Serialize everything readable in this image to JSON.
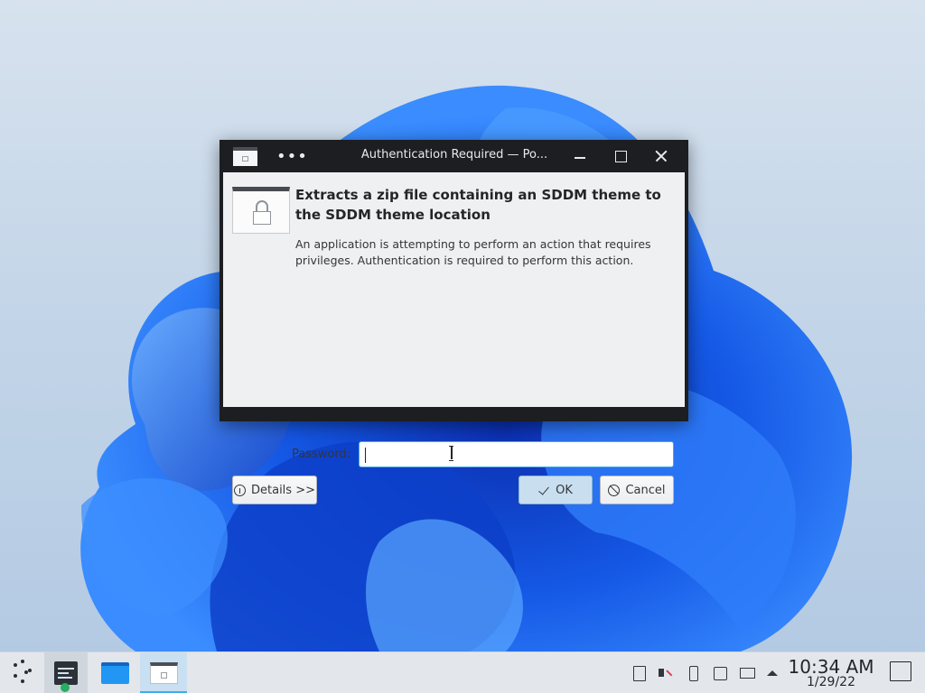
{
  "dialog": {
    "title": "Authentication Required — Po...",
    "heading": "Extracts a zip file containing an SDDM theme to the SDDM theme location",
    "description": "An application is attempting to perform an action that requires privileges. Authentication is required to perform this action.",
    "password_label": "Password:",
    "password_value": "",
    "details_label": "Details >>",
    "ok_label": "OK",
    "cancel_label": "Cancel"
  },
  "taskbar": {
    "time": "10:34 AM",
    "date": "1/29/22",
    "tasks": [
      "settings-icon",
      "folder-icon",
      "lock-window-icon"
    ],
    "tray_icons": [
      "clipboard-icon",
      "volume-muted-icon",
      "usb-icon",
      "input-method-icon",
      "network-icon",
      "expand-tray-icon"
    ]
  },
  "colors": {
    "accent": "#3daee9",
    "titlebar": "#1c1e21",
    "dialog_bg": "#eff0f1",
    "wallpaper_blue": "#1e6ff0"
  }
}
